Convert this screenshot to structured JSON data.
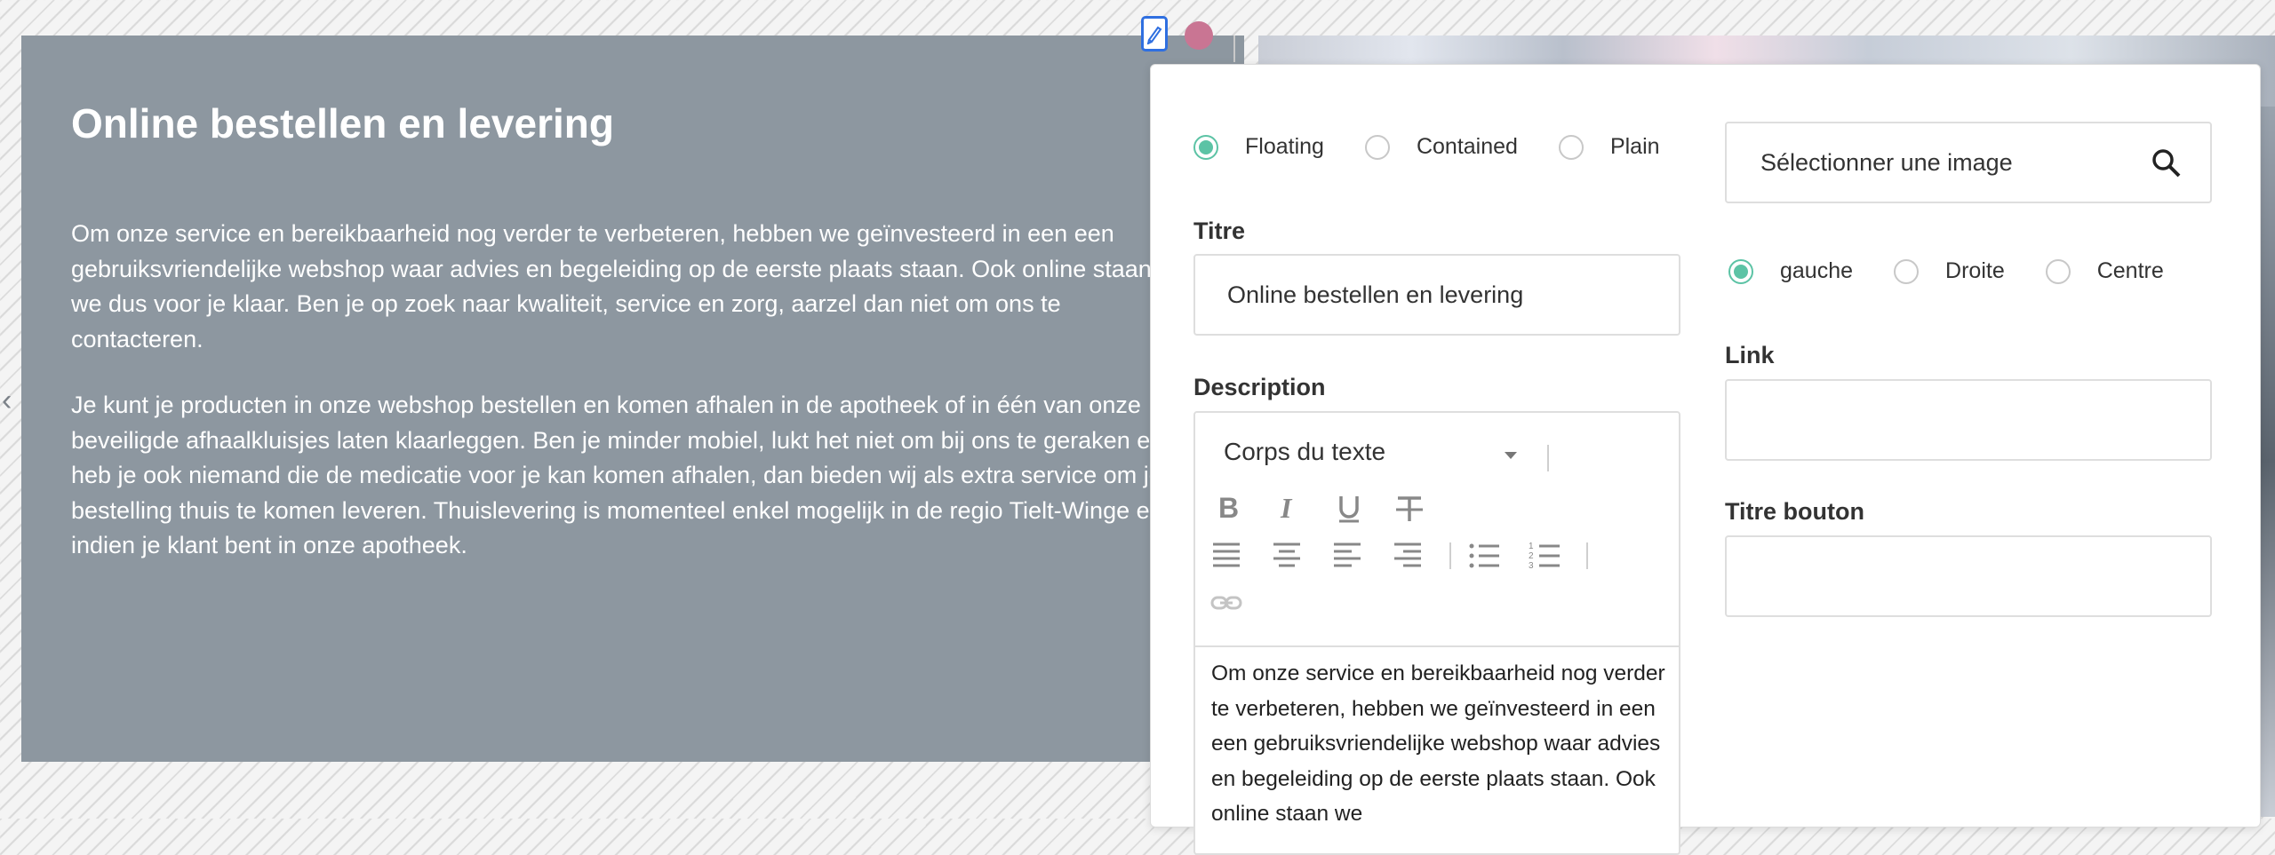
{
  "content": {
    "title": "Online bestellen en levering",
    "paragraph1": "Om onze service en bereikbaarheid nog verder te verbeteren, hebben we geïnvesteerd in een een gebruiksvriendelijke webshop waar advies en begeleiding op de eerste plaats staan. Ook online staan we dus voor je klaar. Ben je op zoek naar kwaliteit, service en zorg, aarzel dan niet om ons te contacteren.",
    "paragraph2": "Je kunt je producten in onze webshop bestellen en komen afhalen in de apotheek of in één van onze beveiligde afhaalkluisjes laten klaarleggen. Ben je minder mobiel, lukt het niet om bij ons te geraken en heb je ook niemand die de medicatie voor je kan komen afhalen, dan bieden wij als extra service om je bestelling thuis te komen leveren. Thuislevering is momenteel enkel mogelijk in de regio Tielt-Winge en indien je klant bent in onze apotheek."
  },
  "panel": {
    "style_options": [
      {
        "label": "Floating",
        "checked": true
      },
      {
        "label": "Contained",
        "checked": false
      },
      {
        "label": "Plain",
        "checked": false
      }
    ],
    "titre_label": "Titre",
    "titre_value": "Online bestellen en levering",
    "description_label": "Description",
    "editor": {
      "format": "Corps du texte",
      "text": "Om onze service en bereikbaarheid nog verder te verbeteren, hebben we geïnvesteerd in een een gebruiksvriendelijke webshop waar advies en begeleiding op de eerste plaats staan. Ook online staan we"
    },
    "image_select_label": "Sélectionner une image",
    "align_options": [
      {
        "label": "gauche",
        "checked": true
      },
      {
        "label": "Droite",
        "checked": false
      },
      {
        "label": "Centre",
        "checked": false
      }
    ],
    "link_label": "Link",
    "link_value": "",
    "button_title_label": "Titre bouton",
    "button_title_value": ""
  },
  "colors": {
    "block_bg": "#8d97a0",
    "accent": "#5cc3a5",
    "edit_icon": "#2f6fe0",
    "drag_handle": "#c97593"
  }
}
